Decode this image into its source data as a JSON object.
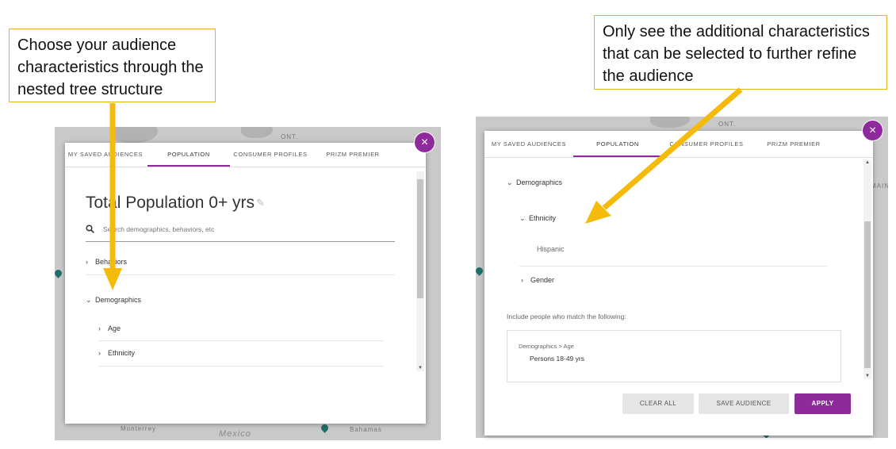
{
  "callouts": {
    "left": "Choose your audience characteristics through the nested tree structure",
    "right": "Only see the additional characteristics that can be selected to further refine the audience"
  },
  "map": {
    "labels": {
      "ont": "ONT.",
      "maine": "MAINE",
      "monterrey": "Monterrey",
      "mexico": "Mexico",
      "bahamas": "Bahamas"
    }
  },
  "tabs": [
    "MY SAVED AUDIENCES",
    "POPULATION",
    "CONSUMER PROFILES",
    "PRIZM PREMIER"
  ],
  "active_tab": "POPULATION",
  "close_label": "×",
  "left_panel": {
    "title": "Total Population 0+ yrs",
    "search_placeholder": "Search demographics, behaviors, etc",
    "tree": {
      "behaviors": "Behaviors",
      "demographics": "Demographics",
      "age": "Age",
      "ethnicity": "Ethnicity"
    }
  },
  "right_panel": {
    "tree": {
      "demographics": "Demographics",
      "ethnicity": "Ethnicity",
      "hispanic": "Hispanic",
      "gender": "Gender"
    },
    "include_label": "Include people who match the following:",
    "selection": {
      "path": "Demographics > Age",
      "value": "Persons 18-49 yrs"
    },
    "buttons": {
      "clear_all": "CLEAR ALL",
      "save_audience": "SAVE AUDIENCE",
      "apply": "APPLY"
    }
  },
  "colors": {
    "accent": "#8e2a9c",
    "arrow": "#f5bb0c",
    "callout_border": "#e0b623"
  }
}
